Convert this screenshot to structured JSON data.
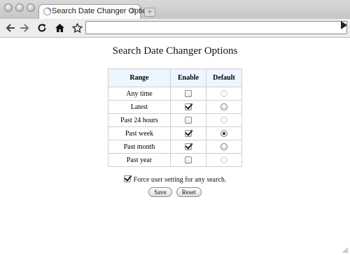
{
  "browser": {
    "tab_title": "Search Date Changer Options",
    "tab_close_glyph": "✕",
    "new_tab_glyph": "+",
    "address_value": ""
  },
  "page": {
    "title": "Search Date Changer Options",
    "columns": [
      "Range",
      "Enable",
      "Default"
    ],
    "rows": [
      {
        "label": "Any time",
        "enabled": false,
        "default": "disabled"
      },
      {
        "label": "Latest",
        "enabled": true,
        "default": "unselected"
      },
      {
        "label": "Past 24 hours",
        "enabled": false,
        "default": "disabled"
      },
      {
        "label": "Past week",
        "enabled": true,
        "default": "selected"
      },
      {
        "label": "Past month",
        "enabled": true,
        "default": "unselected"
      },
      {
        "label": "Past year",
        "enabled": false,
        "default": "disabled"
      }
    ],
    "force_label": "Force user setting for any search.",
    "force_checked": true,
    "save_label": "Save",
    "reset_label": "Reset"
  },
  "icons": {
    "back": "back-arrow-icon",
    "forward": "forward-arrow-icon",
    "reload": "reload-icon",
    "home": "home-icon",
    "bookmark": "star-icon",
    "go": "go-arrow-icon"
  }
}
